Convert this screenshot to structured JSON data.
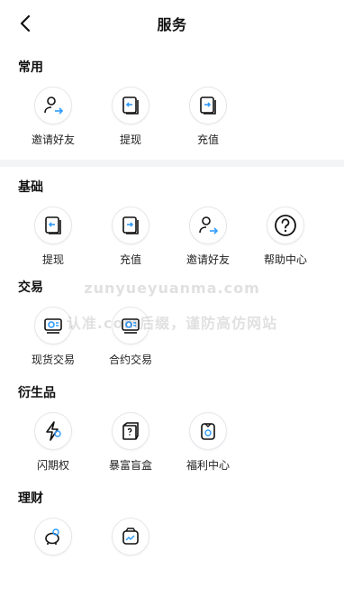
{
  "header": {
    "title": "服务"
  },
  "sections": [
    {
      "title": "常用",
      "items": [
        {
          "label": "邀请好友",
          "icon": "invite-friend-icon"
        },
        {
          "label": "提现",
          "icon": "withdraw-icon"
        },
        {
          "label": "充值",
          "icon": "deposit-icon"
        }
      ]
    },
    {
      "title": "基础",
      "items": [
        {
          "label": "提现",
          "icon": "withdraw-icon"
        },
        {
          "label": "充值",
          "icon": "deposit-icon"
        },
        {
          "label": "邀请好友",
          "icon": "invite-friend-icon"
        },
        {
          "label": "帮助中心",
          "icon": "help-center-icon"
        }
      ]
    },
    {
      "title": "交易",
      "items": [
        {
          "label": "现货交易",
          "icon": "spot-trading-icon"
        },
        {
          "label": "合约交易",
          "icon": "contract-trading-icon"
        }
      ]
    },
    {
      "title": "衍生品",
      "items": [
        {
          "label": "闪期权",
          "icon": "flash-option-icon"
        },
        {
          "label": "暴富盲盒",
          "icon": "mystery-box-icon"
        },
        {
          "label": "福利中心",
          "icon": "welfare-center-icon"
        }
      ]
    },
    {
      "title": "理财",
      "items": [
        {
          "label": "",
          "icon": "piggy-bank-icon"
        },
        {
          "label": "",
          "icon": "chart-wallet-icon"
        }
      ]
    }
  ],
  "watermark": {
    "line1": "zunyueyuanma.com",
    "line2": "认准.com后缀，谨防高仿网站"
  },
  "colors": {
    "accent": "#2f9bff",
    "text": "#111111"
  }
}
